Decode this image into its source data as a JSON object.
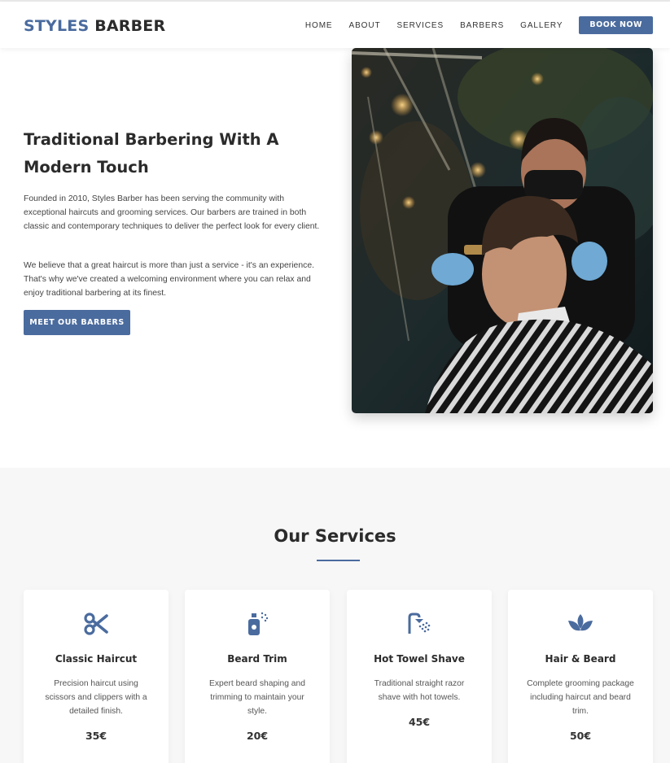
{
  "brand": {
    "part1": "STYLES",
    "part2": "BARBER"
  },
  "nav": {
    "links": [
      "HOME",
      "ABOUT",
      "SERVICES",
      "BARBERS",
      "GALLERY"
    ],
    "cta": "BOOK NOW"
  },
  "hero": {
    "title": "Traditional Barbering With A Modern Touch",
    "paragraph1": "Founded in 2010, Styles Barber has been serving the community with exceptional haircuts and grooming services. Our barbers are trained in both classic and contemporary techniques to deliver the perfect look for every client.",
    "paragraph2": "We believe that a great haircut is more than just a service - it's an experience. That's why we've created a welcoming environment where you can relax and enjoy traditional barbering at its finest.",
    "button": "MEET OUR BARBERS"
  },
  "services": {
    "heading": "Our Services",
    "cards": [
      {
        "icon": "scissors-icon",
        "name": "Classic Haircut",
        "description": "Precision haircut using scissors and clippers with a detailed finish.",
        "price": "35€"
      },
      {
        "icon": "spray-bottle-icon",
        "name": "Beard Trim",
        "description": "Expert beard shaping and trimming to maintain your style.",
        "price": "20€"
      },
      {
        "icon": "shower-icon",
        "name": "Hot Towel Shave",
        "description": "Traditional straight razor shave with hot towels.",
        "price": "45€"
      },
      {
        "icon": "spa-lotus-icon",
        "name": "Hair & Beard",
        "description": "Complete grooming package including haircut and beard trim.",
        "price": "50€"
      }
    ]
  },
  "colors": {
    "accent": "#4a6b9e",
    "text": "#2b2b2b",
    "section_bg": "#f7f7f7"
  }
}
